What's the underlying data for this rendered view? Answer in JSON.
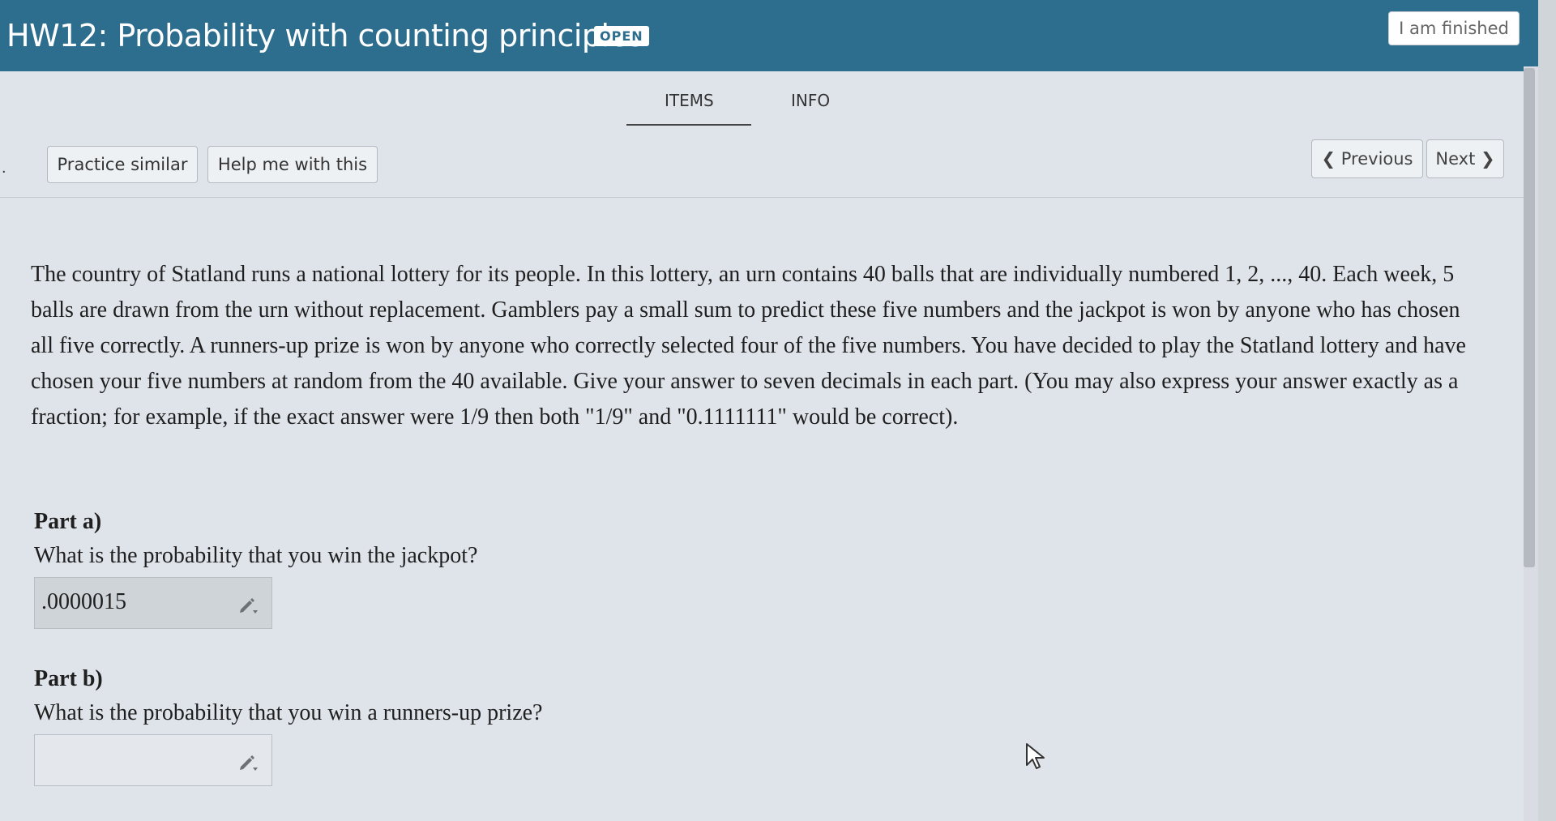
{
  "header": {
    "title": "HW12: Probability with counting principles",
    "badge": "OPEN",
    "finish_label": "I am finished"
  },
  "tabs": [
    {
      "label": "ITEMS",
      "active": true
    },
    {
      "label": "INFO",
      "active": false
    }
  ],
  "toolbar": {
    "practice_label": "Practice similar",
    "help_label": "Help me with this",
    "previous_label": "❮ Previous",
    "next_label": "Next ❯"
  },
  "problem": {
    "text": "The country of Statland runs a national lottery for its people. In this lottery, an urn contains 40 balls that are individually numbered 1, 2, ..., 40. Each week, 5 balls are drawn from the urn without replacement. Gamblers pay a small sum to predict these five numbers and the jackpot is won by anyone who has chosen all five correctly. A runners-up prize is won by anyone who correctly selected four of the five numbers. You have decided to play the Statland lottery and have chosen your five numbers at random from the 40 available. Give your answer to seven decimals in each part. (You may also express your answer exactly as a fraction; for example, if the exact answer were 1/9 then both \"1/9\" and \"0.1111111\" would be correct)."
  },
  "parts": [
    {
      "label": "Part a)",
      "question": "What is the probability that you win the jackpot?",
      "answer": ".0000015"
    },
    {
      "label": "Part b)",
      "question": "What is the probability that you win a runners-up prize?",
      "answer": ""
    }
  ],
  "colors": {
    "header_bg": "#2d6e8e",
    "page_bg": "#dfe4ea"
  },
  "icons": [
    "pencil-icon",
    "mouse-cursor-icon"
  ]
}
